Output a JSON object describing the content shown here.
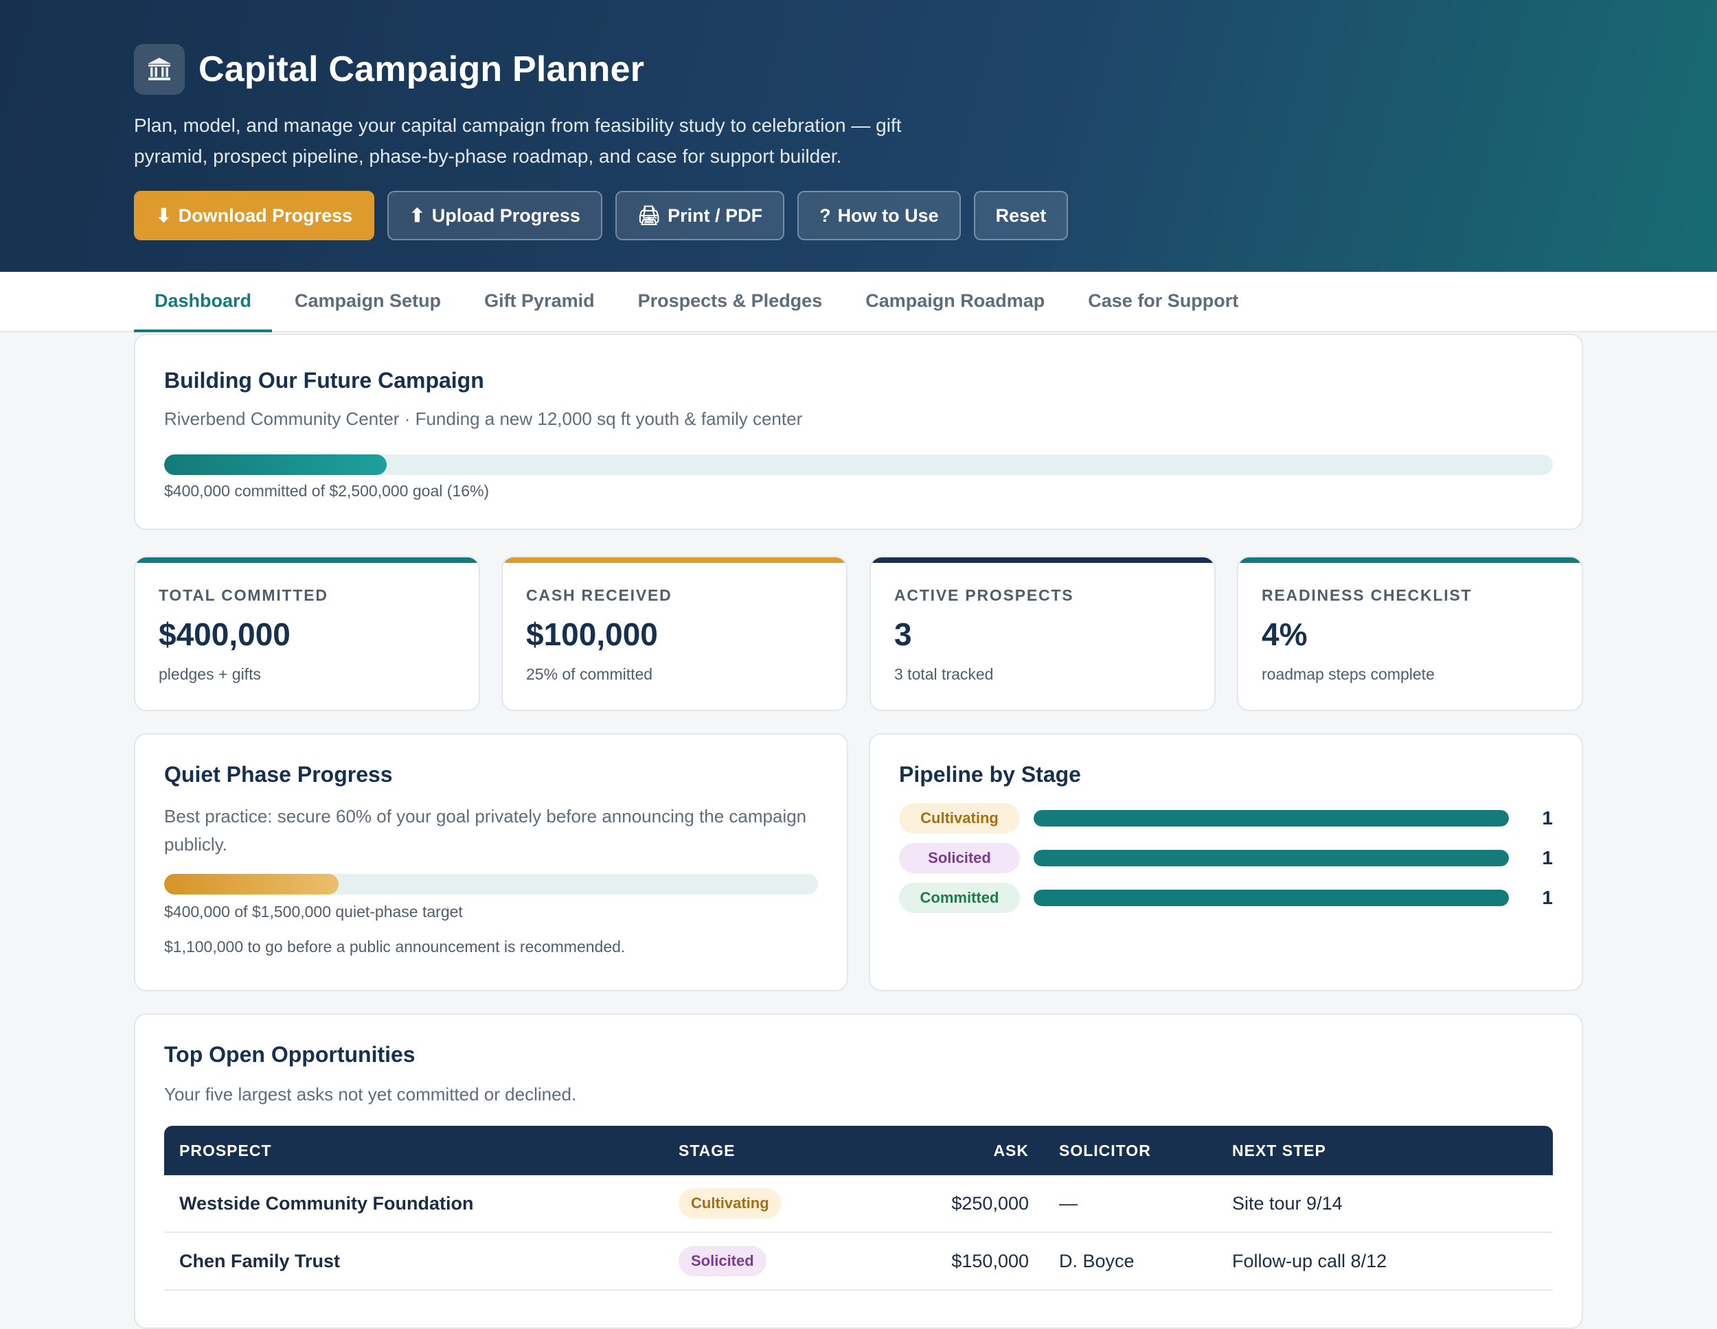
{
  "app": {
    "icon": "bank-building-icon",
    "title": "Capital Campaign Planner",
    "subtitle": "Plan, model, and manage your capital campaign from feasibility study to celebration — gift pyramid, prospect pipeline, phase-by-phase roadmap, and case for support builder."
  },
  "actions": {
    "download": {
      "icon": "⬇",
      "label": "Download Progress"
    },
    "upload": {
      "icon": "⬆",
      "label": "Upload Progress"
    },
    "print": {
      "icon": "🖨",
      "label": "Print / PDF"
    },
    "help": {
      "icon": "?",
      "label": "How to Use"
    },
    "reset": {
      "label": "Reset"
    }
  },
  "tabs": [
    {
      "label": "Dashboard",
      "active": true
    },
    {
      "label": "Campaign Setup"
    },
    {
      "label": "Gift Pyramid"
    },
    {
      "label": "Prospects & Pledges"
    },
    {
      "label": "Campaign Roadmap"
    },
    {
      "label": "Case for Support"
    }
  ],
  "campaign": {
    "name": "Building Our Future Campaign",
    "subtitle": "Riverbend Community Center · Funding a new 12,000 sq ft youth & family center",
    "progress_fraction": 0.16,
    "progress_caption": "$400,000 committed of $2,500,000 goal (16%)"
  },
  "stats": [
    {
      "label": "TOTAL COMMITTED",
      "value": "$400,000",
      "note": "pledges + gifts",
      "accent": "#157a7a"
    },
    {
      "label": "CASH RECEIVED",
      "value": "$100,000",
      "note": "25% of committed",
      "accent": "#de9a2d"
    },
    {
      "label": "ACTIVE PROSPECTS",
      "value": "3",
      "note": "3 total tracked",
      "accent": "#17304f"
    },
    {
      "label": "READINESS CHECKLIST",
      "value": "4%",
      "note": "roadmap steps complete",
      "accent": "#157a7a"
    }
  ],
  "quiet_phase": {
    "title": "Quiet Phase Progress",
    "description": "Best practice: secure 60% of your goal privately before announcing the campaign publicly.",
    "progress_fraction": 0.267,
    "caption": "$400,000 of $1,500,000 quiet-phase target",
    "remaining": "$1,100,000 to go before a public announcement is recommended."
  },
  "pipeline": {
    "title": "Pipeline by Stage",
    "stages": [
      {
        "label": "Cultivating",
        "count": "1",
        "fraction": 1.0
      },
      {
        "label": "Solicited",
        "count": "1",
        "fraction": 1.0
      },
      {
        "label": "Committed",
        "count": "1",
        "fraction": 1.0
      }
    ]
  },
  "opportunities": {
    "title": "Top Open Opportunities",
    "description": "Your five largest asks not yet committed or declined.",
    "columns": {
      "prospect": "PROSPECT",
      "stage": "STAGE",
      "ask": "ASK",
      "solicitor": "SOLICITOR",
      "next_step": "NEXT STEP"
    },
    "rows": [
      {
        "prospect": "Westside Community Foundation",
        "stage": "Cultivating",
        "ask": "$250,000",
        "solicitor": "—",
        "next_step": "Site tour 9/14"
      },
      {
        "prospect": "Chen Family Trust",
        "stage": "Solicited",
        "ask": "$150,000",
        "solicitor": "D. Boyce",
        "next_step": "Follow-up call 8/12"
      }
    ]
  }
}
